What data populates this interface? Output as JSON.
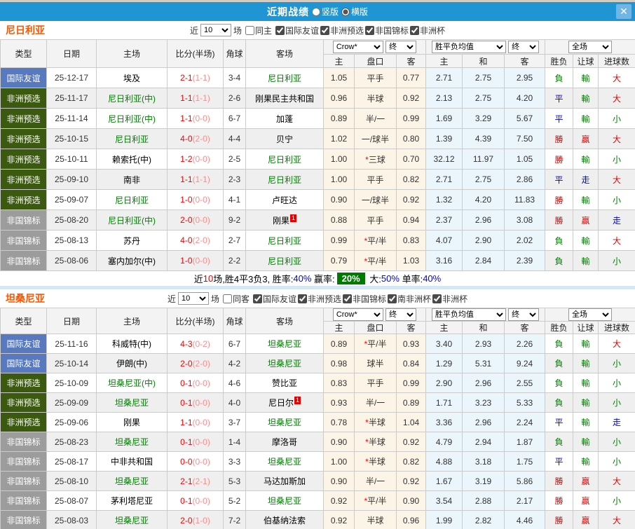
{
  "titlebar": {
    "title": "近期战绩",
    "layout_options": [
      {
        "label": "竖版",
        "selected": false
      },
      {
        "label": "横版",
        "selected": true
      }
    ],
    "close_icon": "✕"
  },
  "columns": {
    "type": "类型",
    "date": "日期",
    "home": "主场",
    "score": "比分(半场)",
    "corners": "角球",
    "away": "客场",
    "odds_company": "Crow*",
    "final": "终",
    "avg": "胜平负均值",
    "full": "全场",
    "sub": {
      "home": "主",
      "handicap": "盘口",
      "away": "客",
      "avg_home": "主",
      "avg_draw": "和",
      "avg_away": "客",
      "result": "胜负",
      "handicap_result": "让球",
      "goals": "进球数"
    }
  },
  "sections": [
    {
      "name": "尼日利亚",
      "filter": {
        "near": "近",
        "count": "10",
        "games": "场",
        "same": "同主",
        "same_checked": false,
        "competitions": [
          {
            "label": "国际友谊",
            "checked": true
          },
          {
            "label": "非洲预选",
            "checked": true
          },
          {
            "label": "非国锦标",
            "checked": true
          },
          {
            "label": "非洲杯",
            "checked": true
          }
        ]
      },
      "rows": [
        {
          "type": "国际友谊",
          "date": "25-12-17",
          "home": "埃及",
          "score": "2-1",
          "half": "(1-1)",
          "corners": "3-4",
          "away": "尼日利亚",
          "odds_home": "1.05",
          "handicap": "平手",
          "odds_away": "0.77",
          "avg_home": "2.71",
          "avg_draw": "2.75",
          "avg_away": "2.95",
          "result": "負",
          "handicap_result": "輸",
          "goals": "大"
        },
        {
          "type": "非洲预选",
          "date": "25-11-17",
          "home": "尼日利亚(中)",
          "score": "1-1",
          "half": "(1-1)",
          "corners": "2-6",
          "away": "刚果民主共和国",
          "odds_home": "0.96",
          "handicap": "半球",
          "odds_away": "0.92",
          "avg_home": "2.13",
          "avg_draw": "2.75",
          "avg_away": "4.20",
          "result": "平",
          "handicap_result": "輸",
          "goals": "大"
        },
        {
          "type": "非洲预选",
          "date": "25-11-14",
          "home": "尼日利亚(中)",
          "score": "1-1",
          "half": "(0-0)",
          "corners": "6-7",
          "away": "加蓬",
          "odds_home": "0.89",
          "handicap": "半/一",
          "odds_away": "0.99",
          "avg_home": "1.69",
          "avg_draw": "3.29",
          "avg_away": "5.67",
          "result": "平",
          "handicap_result": "輸",
          "goals": "小"
        },
        {
          "type": "非洲预选",
          "date": "25-10-15",
          "home": "尼日利亚",
          "score": "4-0",
          "half": "(2-0)",
          "corners": "4-4",
          "away": "贝宁",
          "odds_home": "1.02",
          "handicap": "一/球半",
          "odds_away": "0.80",
          "avg_home": "1.39",
          "avg_draw": "4.39",
          "avg_away": "7.50",
          "result": "勝",
          "handicap_result": "贏",
          "goals": "大"
        },
        {
          "type": "非洲预选",
          "date": "25-10-11",
          "home": "赖索托(中)",
          "score": "1-2",
          "half": "(0-0)",
          "corners": "2-5",
          "away": "尼日利亚",
          "odds_home": "1.00",
          "handicap": "*三球",
          "odds_away": "0.70",
          "avg_home": "32.12",
          "avg_draw": "11.97",
          "avg_away": "1.05",
          "result": "勝",
          "handicap_result": "輸",
          "goals": "小"
        },
        {
          "type": "非洲预选",
          "date": "25-09-10",
          "home": "南非",
          "score": "1-1",
          "half": "(1-1)",
          "corners": "2-3",
          "away": "尼日利亚",
          "odds_home": "1.00",
          "handicap": "平手",
          "odds_away": "0.82",
          "avg_home": "2.71",
          "avg_draw": "2.75",
          "avg_away": "2.86",
          "result": "平",
          "handicap_result": "走",
          "goals": "大"
        },
        {
          "type": "非洲预选",
          "date": "25-09-07",
          "home": "尼日利亚",
          "score": "1-0",
          "half": "(0-0)",
          "corners": "4-1",
          "away": "卢旺达",
          "odds_home": "0.90",
          "handicap": "一/球半",
          "odds_away": "0.92",
          "avg_home": "1.32",
          "avg_draw": "4.20",
          "avg_away": "11.83",
          "result": "勝",
          "handicap_result": "輸",
          "goals": "小"
        },
        {
          "type": "非国锦标",
          "date": "25-08-20",
          "home": "尼日利亚(中)",
          "score": "2-0",
          "half": "(0-0)",
          "corners": "9-2",
          "away": "刚果",
          "away_sup": "1",
          "odds_home": "0.88",
          "handicap": "平手",
          "odds_away": "0.94",
          "avg_home": "2.37",
          "avg_draw": "2.96",
          "avg_away": "3.08",
          "result": "勝",
          "handicap_result": "贏",
          "goals": "走"
        },
        {
          "type": "非国锦标",
          "date": "25-08-13",
          "home": "苏丹",
          "score": "4-0",
          "half": "(2-0)",
          "corners": "2-7",
          "away": "尼日利亚",
          "odds_home": "0.99",
          "handicap": "*平/半",
          "odds_away": "0.83",
          "avg_home": "4.07",
          "avg_draw": "2.90",
          "avg_away": "2.02",
          "result": "負",
          "handicap_result": "輸",
          "goals": "大"
        },
        {
          "type": "非国锦标",
          "date": "25-08-06",
          "home": "塞内加尔(中)",
          "score": "1-0",
          "half": "(0-0)",
          "corners": "2-2",
          "away": "尼日利亚",
          "odds_home": "0.79",
          "handicap": "*平/半",
          "odds_away": "1.03",
          "avg_home": "3.16",
          "avg_draw": "2.84",
          "avg_away": "2.39",
          "result": "負",
          "handicap_result": "輸",
          "goals": "小"
        }
      ],
      "summary": [
        {
          "t": "近"
        },
        {
          "t": "10",
          "c": "red"
        },
        {
          "t": "场,胜4平3负3, 胜率:"
        },
        {
          "t": "40%",
          "c": "blue"
        },
        {
          "t": " 赢率:"
        },
        {
          "t": "20%",
          "c": "badge"
        },
        {
          "t": " 大:"
        },
        {
          "t": "50%",
          "c": "blue"
        },
        {
          "t": " 单率:"
        },
        {
          "t": "40%",
          "c": "blue"
        }
      ]
    },
    {
      "name": "坦桑尼亚",
      "filter": {
        "near": "近",
        "count": "10",
        "games": "场",
        "same": "同客",
        "same_checked": false,
        "competitions": [
          {
            "label": "国际友谊",
            "checked": true
          },
          {
            "label": "非洲预选",
            "checked": true
          },
          {
            "label": "非国锦标",
            "checked": true
          },
          {
            "label": "南非洲杯",
            "checked": true
          },
          {
            "label": "非洲杯",
            "checked": true
          }
        ]
      },
      "rows": [
        {
          "type": "国际友谊",
          "date": "25-11-16",
          "home": "科威特(中)",
          "score": "4-3",
          "half": "(0-2)",
          "corners": "6-7",
          "away": "坦桑尼亚",
          "odds_home": "0.89",
          "handicap": "*平/半",
          "odds_away": "0.93",
          "avg_home": "3.40",
          "avg_draw": "2.93",
          "avg_away": "2.26",
          "result": "負",
          "handicap_result": "輸",
          "goals": "大"
        },
        {
          "type": "国际友谊",
          "date": "25-10-14",
          "home": "伊朗(中)",
          "score": "2-0",
          "half": "(2-0)",
          "corners": "4-2",
          "away": "坦桑尼亚",
          "odds_home": "0.98",
          "handicap": "球半",
          "odds_away": "0.84",
          "avg_home": "1.29",
          "avg_draw": "5.31",
          "avg_away": "9.24",
          "result": "負",
          "handicap_result": "輸",
          "goals": "小"
        },
        {
          "type": "非洲预选",
          "date": "25-10-09",
          "home": "坦桑尼亚(中)",
          "score": "0-1",
          "half": "(0-0)",
          "corners": "4-6",
          "away": "赞比亚",
          "odds_home": "0.83",
          "handicap": "平手",
          "odds_away": "0.99",
          "avg_home": "2.90",
          "avg_draw": "2.96",
          "avg_away": "2.55",
          "result": "負",
          "handicap_result": "輸",
          "goals": "小"
        },
        {
          "type": "非洲预选",
          "date": "25-09-09",
          "home": "坦桑尼亚",
          "score": "0-1",
          "half": "(0-0)",
          "corners": "4-0",
          "away": "尼日尔",
          "away_sup": "1",
          "odds_home": "0.93",
          "handicap": "半/一",
          "odds_away": "0.89",
          "avg_home": "1.71",
          "avg_draw": "3.23",
          "avg_away": "5.33",
          "result": "負",
          "handicap_result": "輸",
          "goals": "小"
        },
        {
          "type": "非洲预选",
          "date": "25-09-06",
          "home": "刚果",
          "score": "1-1",
          "half": "(0-0)",
          "corners": "3-7",
          "away": "坦桑尼亚",
          "odds_home": "0.78",
          "handicap": "*半球",
          "odds_away": "1.04",
          "avg_home": "3.36",
          "avg_draw": "2.96",
          "avg_away": "2.24",
          "result": "平",
          "handicap_result": "輸",
          "goals": "走"
        },
        {
          "type": "非国锦标",
          "date": "25-08-23",
          "home": "坦桑尼亚",
          "score": "0-1",
          "half": "(0-0)",
          "corners": "1-4",
          "away": "摩洛哥",
          "odds_home": "0.90",
          "handicap": "*半球",
          "odds_away": "0.92",
          "avg_home": "4.79",
          "avg_draw": "2.94",
          "avg_away": "1.87",
          "result": "負",
          "handicap_result": "輸",
          "goals": "小"
        },
        {
          "type": "非国锦标",
          "date": "25-08-17",
          "home": "中非共和国",
          "score": "0-0",
          "half": "(0-0)",
          "corners": "3-3",
          "away": "坦桑尼亚",
          "odds_home": "1.00",
          "handicap": "*半球",
          "odds_away": "0.82",
          "avg_home": "4.88",
          "avg_draw": "3.18",
          "avg_away": "1.75",
          "result": "平",
          "handicap_result": "輸",
          "goals": "小"
        },
        {
          "type": "非国锦标",
          "date": "25-08-10",
          "home": "坦桑尼亚",
          "score": "2-1",
          "half": "(2-1)",
          "corners": "5-3",
          "away": "马达加斯加",
          "odds_home": "0.90",
          "handicap": "半/一",
          "odds_away": "0.92",
          "avg_home": "1.67",
          "avg_draw": "3.19",
          "avg_away": "5.86",
          "result": "勝",
          "handicap_result": "贏",
          "goals": "大"
        },
        {
          "type": "非国锦标",
          "date": "25-08-07",
          "home": "茅利塔尼亚",
          "score": "0-1",
          "half": "(0-0)",
          "corners": "5-2",
          "away": "坦桑尼亚",
          "odds_home": "0.92",
          "handicap": "*平/半",
          "odds_away": "0.90",
          "avg_home": "3.54",
          "avg_draw": "2.88",
          "avg_away": "2.17",
          "result": "勝",
          "handicap_result": "贏",
          "goals": "小"
        },
        {
          "type": "非国锦标",
          "date": "25-08-03",
          "home": "坦桑尼亚",
          "score": "2-0",
          "half": "(1-0)",
          "corners": "7-2",
          "away": "伯基纳法索",
          "odds_home": "0.92",
          "handicap": "半球",
          "odds_away": "0.96",
          "avg_home": "1.99",
          "avg_draw": "2.82",
          "avg_away": "4.46",
          "result": "勝",
          "handicap_result": "贏",
          "goals": "大"
        }
      ]
    }
  ],
  "colors": {
    "titlebar_blue": "#1F96D3",
    "close_button_blue": "#6FB5E5",
    "section_title_orange": "#FF5500",
    "type_friendly_blue": "#5879BD",
    "type_qualifier_olive": "#3C5A0F",
    "type_championship_gray": "#9C9C9C",
    "focal_team_green": "#008000",
    "score_red": "#FE0000",
    "win_red": "#E60000",
    "draw_blue": "#0000EE",
    "loss_green": "#008000",
    "summary_badge_green": "#007A00",
    "handicap_tint": "#FCF4E6",
    "avg_tint": "#EAF5FC"
  }
}
